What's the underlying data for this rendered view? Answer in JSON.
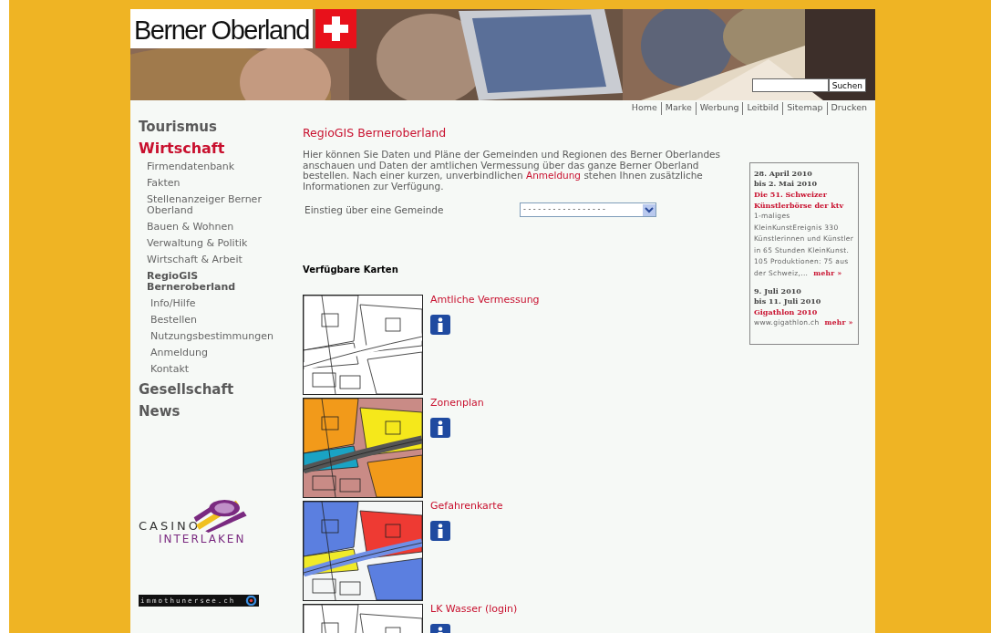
{
  "header": {
    "logo": "Berner Oberland",
    "search": {
      "button": "Suchen"
    }
  },
  "top_links": [
    "Home",
    "Marke",
    "Werbung",
    "Leitbild",
    "Sitemap",
    "Drucken"
  ],
  "sidebar": {
    "items": [
      {
        "label": "Tourismus",
        "selected": false
      },
      {
        "label": "Wirtschaft",
        "selected": true,
        "children": [
          {
            "label": "Firmendatenbank",
            "selected": false
          },
          {
            "label": "Fakten",
            "selected": false
          },
          {
            "label": "Stellenanzeiger Berner Oberland",
            "selected": false
          },
          {
            "label": "Bauen & Wohnen",
            "selected": false
          },
          {
            "label": "Verwaltung & Politik",
            "selected": false
          },
          {
            "label": "Wirtschaft & Arbeit",
            "selected": false
          },
          {
            "label": "RegioGIS Berneroberland",
            "selected": true,
            "children": [
              {
                "label": "Info/Hilfe",
                "selected": false
              },
              {
                "label": "Bestellen",
                "selected": false
              },
              {
                "label": "Nutzungsbestimmungen",
                "selected": false
              },
              {
                "label": "Anmeldung",
                "selected": false
              },
              {
                "label": "Kontakt",
                "selected": false
              }
            ]
          }
        ]
      },
      {
        "label": "Gesellschaft",
        "selected": false
      },
      {
        "label": "News",
        "selected": false
      }
    ]
  },
  "sponsors": [
    {
      "kind": "casino",
      "line_1": "CASINO",
      "line_2": "INTERLAKEN"
    },
    {
      "kind": "banner",
      "text": "immothunersee.ch"
    }
  ],
  "main": {
    "title": "RegioGIS Berneroberland",
    "intro": {
      "before": "Hier können Sie Daten und Pläne der Gemeinden und Regionen des Berner Oberlandes anschauen und Daten der amtlichen Vermessung über das ganze Berner Oberland bestellen. Nach einer kurzen, unverbindlichen",
      "link": "Anmeldung",
      "after": "stehen Ihnen zusätzliche Informationen zur Verfügung."
    },
    "select": {
      "label": "Einstieg über eine Gemeinde",
      "value": "- - - - - - - - - - - - - - - - -"
    },
    "maps_heading": "Verfügbare Karten",
    "maps": [
      {
        "title": "Amtliche Vermessung",
        "kind": "picture"
      },
      {
        "title": "Zonenplan",
        "kind": "picture"
      },
      {
        "title": "Gefahrenkarte",
        "kind": "picture"
      },
      {
        "title": "LK Wasser (login)",
        "kind": "picture"
      }
    ]
  },
  "events": [
    {
      "date_from": "28. April 2010",
      "date_to": "bis 2. Mai 2010",
      "title": "Die 51. Schweizer Künstlerbörse der ktv",
      "text": "1-maliges KleinKunstEreignis 330 Künstlerinnen und Künstler in 65 Stunden KleinKunst. 105 Produktionen: 75 aus der Schweiz,...",
      "more": "mehr »"
    },
    {
      "date_from": "9. Juli 2010",
      "date_to": "bis 11. Juli 2010",
      "title": "Gigathlon 2010",
      "text": "www.gigathlon.ch",
      "more": "mehr »"
    }
  ]
}
